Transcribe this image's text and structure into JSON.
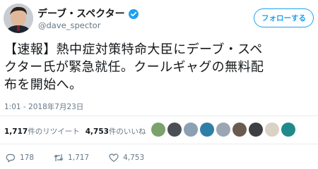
{
  "user": {
    "display_name": "デーブ・スペクター",
    "handle": "@dave_spector"
  },
  "follow_button": {
    "label": "フォローする"
  },
  "tweet": {
    "lines": [
      "【速報】熱中症対策特命大臣にデーブ・スペ",
      "クター氏が緊急就任。クールギャグの無料配",
      "布を開始へ。"
    ],
    "timestamp": "1:01 - 2018年7月23日"
  },
  "stats": {
    "retweets_count": "1,717",
    "retweets_label": "件のリツイート",
    "likes_count": "4,753",
    "likes_label": "件のいいね"
  },
  "liker_avatars": [
    {
      "name": "liker-avatar-1",
      "color": "#7aa26a"
    },
    {
      "name": "liker-avatar-2",
      "color": "#4a4f55"
    },
    {
      "name": "liker-avatar-3",
      "color": "#8ba0b4"
    },
    {
      "name": "liker-avatar-4",
      "color": "#2f7ea8"
    },
    {
      "name": "liker-avatar-5",
      "color": "#9aa6b2"
    },
    {
      "name": "liker-avatar-6",
      "color": "#6b5a4e"
    },
    {
      "name": "liker-avatar-7",
      "color": "#3d3f42"
    },
    {
      "name": "liker-avatar-8",
      "color": "#d9d2c5"
    },
    {
      "name": "liker-avatar-9",
      "color": "#1f8a8a"
    }
  ],
  "actions": {
    "reply_count": "178",
    "retweet_count": "1,717",
    "like_count": "4,753"
  },
  "colors": {
    "accent": "#1da1f2",
    "secondary_text": "#657786"
  }
}
